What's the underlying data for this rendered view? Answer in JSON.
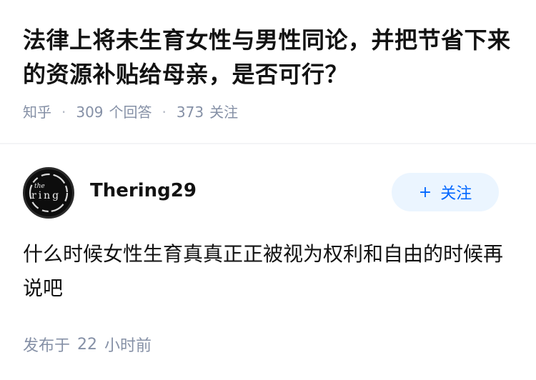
{
  "question": {
    "title": "法律上将未生育女性与男性同论，并把节省下来的资源补贴给母亲，是否可行？",
    "source": "知乎",
    "separator": "·",
    "answer_count": "309",
    "answer_label": "个回答",
    "follower_count": "373",
    "follower_label": "关注"
  },
  "author": {
    "name": "Thering29",
    "avatar_text": "the ring",
    "follow_plus": "+",
    "follow_label": "关注"
  },
  "answer": {
    "content": "什么时候女性生育真真正正被视为权利和自由的时候再说吧"
  },
  "post_time": {
    "prefix": "发布于",
    "value": "22",
    "unit": "小时前"
  },
  "colors": {
    "accent": "#0066ff",
    "follow_bg": "#ebf5ff",
    "meta_gray": "#8590a6",
    "text": "#121212"
  }
}
